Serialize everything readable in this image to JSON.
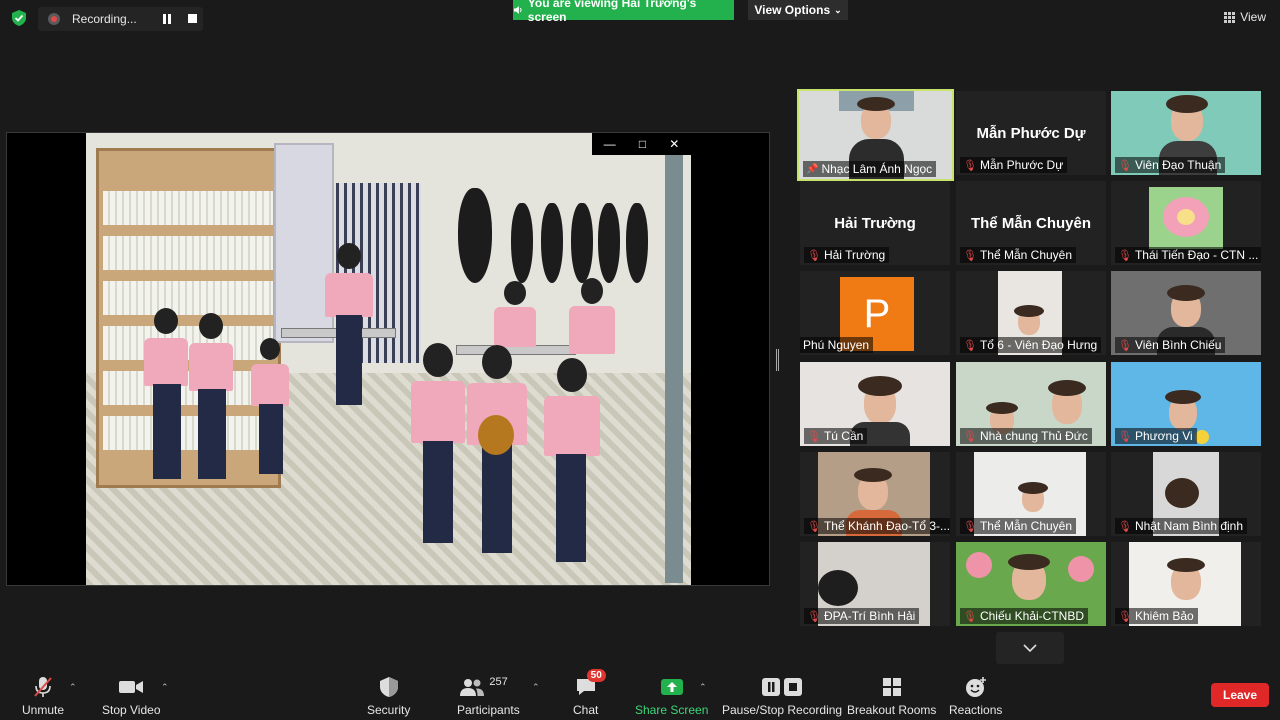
{
  "top": {
    "recording_label": "Recording...",
    "viewing_banner": "You are viewing Hải Trường's screen",
    "view_options_label": "View Options",
    "view_label": "View"
  },
  "gallery": {
    "tiles": [
      {
        "name": "Nhạc Lâm Ánh Ngọc",
        "video": true,
        "active": true
      },
      {
        "name": "Mẫn Phước Dự",
        "big_name": "Mẫn Phước Dự",
        "video": false
      },
      {
        "name": "Viên Đạo Thuận",
        "video": true
      },
      {
        "name": "Hải Trường",
        "big_name": "Hải Trường",
        "video": false
      },
      {
        "name": "Thể Mẫn Chuyên",
        "big_name": "Thể Mẫn Chuyên",
        "video": false
      },
      {
        "name": "Thái Tiến Đạo - CTN ...",
        "video": true
      },
      {
        "name": "Phú Nguyen",
        "avatar_letter": "P",
        "video": false
      },
      {
        "name": "Tổ 6 - Viên Đạo Hưng",
        "video": true
      },
      {
        "name": "Viên Bình Chiếu",
        "video": true
      },
      {
        "name": "Tú Cần",
        "video": true
      },
      {
        "name": "Nhà chung Thủ Đức",
        "video": true
      },
      {
        "name": "Phương Vi",
        "video": true
      },
      {
        "name": "Thể Khánh Đạo-Tổ 3-...",
        "video": true
      },
      {
        "name": "Thể Mẫn Chuyên",
        "video": true
      },
      {
        "name": "Nhật Nam Bình định",
        "video": true
      },
      {
        "name": "ĐPA-Trí Bình Hải",
        "video": true
      },
      {
        "name": "Chiếu Khải-CTNBD",
        "video": true
      },
      {
        "name": "Khiêm Bảo",
        "video": true
      }
    ]
  },
  "toolbar": {
    "unmute": "Unmute",
    "stop_video": "Stop Video",
    "security": "Security",
    "participants": "Participants",
    "participants_count": "257",
    "chat": "Chat",
    "chat_badge": "50",
    "share_screen": "Share Screen",
    "pause_recording": "Pause/Stop Recording",
    "breakout_rooms": "Breakout Rooms",
    "reactions": "Reactions",
    "leave": "Leave"
  },
  "colors": {
    "share_green": "#22b14c",
    "active_speaker": "#c8e36b",
    "leave_red": "#e02828",
    "avatar_orange": "#f07b14"
  }
}
